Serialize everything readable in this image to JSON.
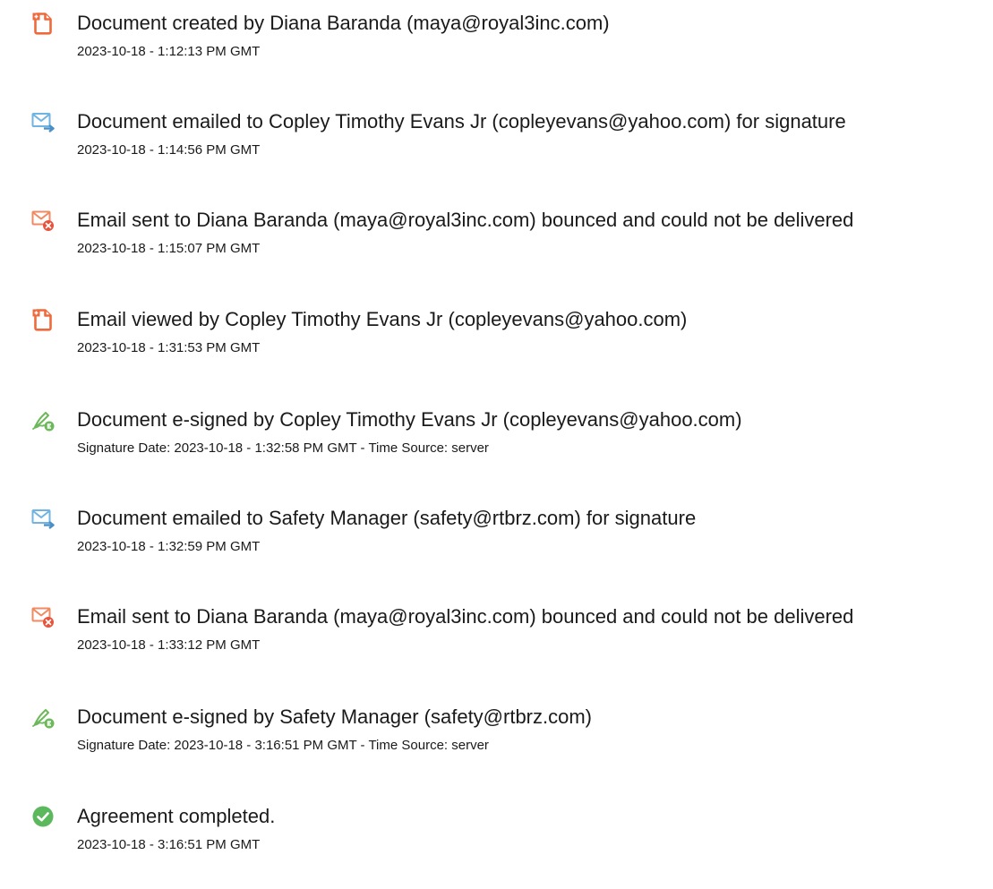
{
  "events": [
    {
      "icon": "document-created-icon",
      "text": "Document created by Diana Baranda (maya@royal3inc.com)",
      "timestamp": "2023-10-18 - 1:12:13 PM GMT"
    },
    {
      "icon": "email-sent-icon",
      "text": "Document emailed to Copley Timothy Evans Jr (copleyevans@yahoo.com) for signature",
      "timestamp": "2023-10-18 - 1:14:56 PM GMT"
    },
    {
      "icon": "email-bounced-icon",
      "text": "Email sent to Diana Baranda (maya@royal3inc.com) bounced and could not be delivered",
      "timestamp": "2023-10-18 - 1:15:07 PM GMT"
    },
    {
      "icon": "document-viewed-icon",
      "text": "Email viewed by Copley Timothy Evans Jr (copleyevans@yahoo.com)",
      "timestamp": "2023-10-18 - 1:31:53 PM GMT"
    },
    {
      "icon": "e-signed-icon",
      "text": "Document e-signed by Copley Timothy Evans Jr (copleyevans@yahoo.com)",
      "timestamp": "Signature Date: 2023-10-18 - 1:32:58 PM GMT - Time Source: server"
    },
    {
      "icon": "email-sent-icon",
      "text": "Document emailed to Safety Manager (safety@rtbrz.com) for signature",
      "timestamp": "2023-10-18 - 1:32:59 PM GMT"
    },
    {
      "icon": "email-bounced-icon",
      "text": "Email sent to Diana Baranda (maya@royal3inc.com) bounced and could not be delivered",
      "timestamp": "2023-10-18 - 1:33:12 PM GMT"
    },
    {
      "icon": "e-signed-icon",
      "text": "Document e-signed by Safety Manager (safety@rtbrz.com)",
      "timestamp": "Signature Date: 2023-10-18 - 3:16:51 PM GMT - Time Source: server"
    },
    {
      "icon": "agreement-completed-icon",
      "text": "Agreement completed.",
      "timestamp": "2023-10-18 - 3:16:51 PM GMT"
    }
  ],
  "colors": {
    "document_orange": "#ee6a3c",
    "email_blue": "#6fb4e3",
    "bounce_orange": "#f08a63",
    "bounce_red": "#e8533c",
    "esign_green": "#6cb85a",
    "complete_green": "#5cb85c"
  }
}
